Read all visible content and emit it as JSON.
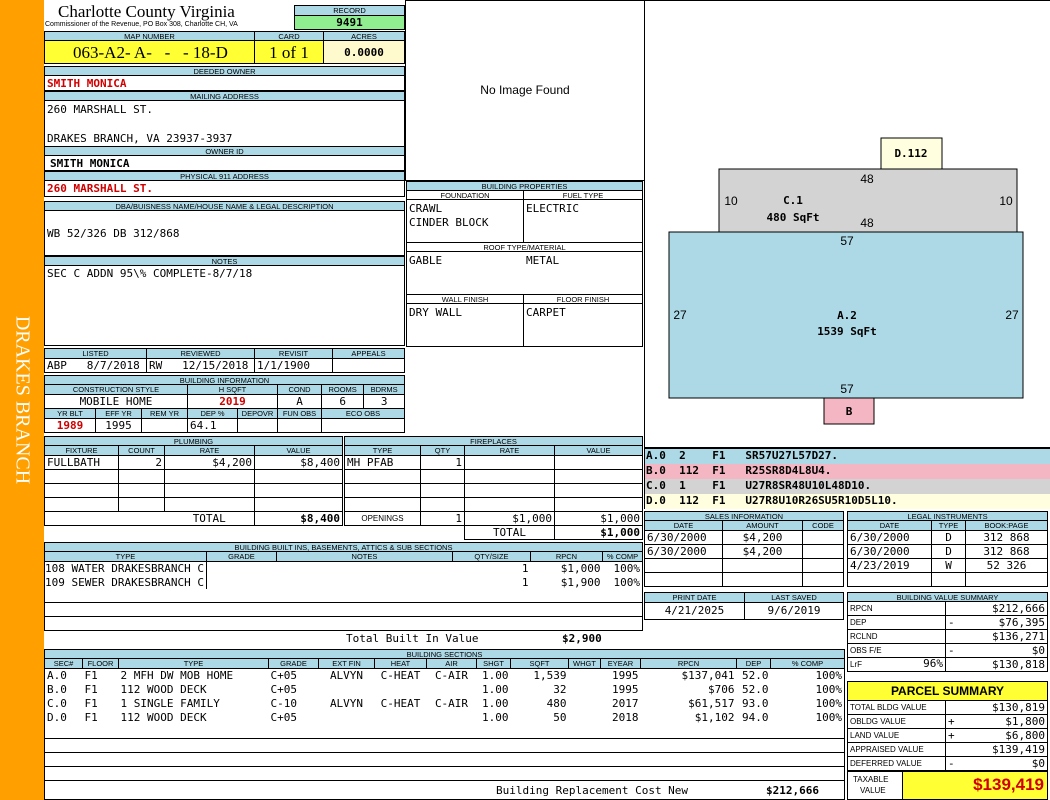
{
  "side_label": "DRAKES BRANCH",
  "header": {
    "county": "Charlotte County Virginia",
    "commissioner": "Commissioner of the Revenue, PO Box 308, Charlotte CH, VA",
    "record_label": "RECORD",
    "record": "9491",
    "map_number_label": "MAP NUMBER",
    "map_number": "063-A2- A-   -   - 18-D",
    "card_label": "CARD",
    "card": "1 of 1",
    "acres_label": "ACRES",
    "acres": "0.0000"
  },
  "owner": {
    "deeded_owner_label": "DEEDED OWNER",
    "deeded_owner": "SMITH MONICA",
    "mailing_label": "MAILING ADDRESS",
    "mailing_line1": "260 MARSHALL ST.",
    "mailing_line2": "DRAKES BRANCH, VA 23937-3937",
    "owner_id_label": "OWNER ID",
    "owner_id": "SMITH MONICA",
    "physical_label": "PHYSICAL 911 ADDRESS",
    "physical": "260 MARSHALL ST.",
    "dba_label": "DBA/BUISNESS NAME/HOUSE NAME & LEGAL DESCRIPTION",
    "dba": "WB 52/326 DB 312/868",
    "notes_label": "NOTES",
    "notes": "SEC C ADDN 95\\% COMPLETE-8/7/18"
  },
  "image_placeholder": "No Image Found",
  "building_properties": {
    "title": "BUILDING PROPERTIES",
    "foundation_label": "FOUNDATION",
    "foundation": [
      "CRAWL",
      "CINDER BLOCK"
    ],
    "fuel_label": "FUEL TYPE",
    "fuel": "ELECTRIC",
    "roof_label": "ROOF TYPE/MATERIAL",
    "roof_type": "GABLE",
    "roof_material": "METAL",
    "wall_label": "WALL FINISH",
    "wall": "DRY WALL",
    "floor_label": "FLOOR FINISH",
    "floor": "CARPET"
  },
  "listing": {
    "listed_label": "LISTED",
    "listed_by": "ABP",
    "listed_date": "8/7/2018",
    "reviewed_label": "REVIEWED",
    "reviewed_by": "RW",
    "reviewed_date": "12/15/2018",
    "revisit_label": "REVISIT",
    "revisit": "1/1/1900",
    "appeals_label": "APPEALS",
    "appeals": ""
  },
  "building_info": {
    "title": "BUILDING INFORMATION",
    "style_label": "CONSTRUCTION STYLE",
    "style": "MOBILE HOME",
    "hsqft_label": "H SQFT",
    "hsqft": "2019",
    "cond_label": "COND",
    "cond": "A",
    "rooms_label": "ROOMS",
    "rooms": "6",
    "bdrms_label": "BDRMS",
    "bdrms": "3",
    "yrblt_label": "YR BLT",
    "yrblt": "1989",
    "effyr_label": "EFF YR",
    "effyr": "1995",
    "remyr_label": "REM YR",
    "remyr": "",
    "dep_label": "DEP %",
    "dep": "64.1",
    "depovr_label": "DEPOVR",
    "depovr": "",
    "funobs_label": "FUN OBS",
    "funobs": "",
    "ecoobs_label": "ECO OBS",
    "ecoobs": ""
  },
  "plumbing": {
    "title": "PLUMBING",
    "headers": [
      "FIXTURE",
      "COUNT",
      "RATE",
      "VALUE"
    ],
    "rows": [
      [
        "FULLBATH",
        "2",
        "$4,200",
        "$8,400"
      ]
    ],
    "total_label": "TOTAL",
    "total": "$8,400"
  },
  "fireplaces": {
    "title": "FIREPLACES",
    "headers": [
      "TYPE",
      "QTY",
      "RATE",
      "VALUE"
    ],
    "rows": [
      [
        "MH PFAB",
        "1",
        "",
        ""
      ]
    ],
    "openings_label": "OPENINGS",
    "openings_qty": "1",
    "openings_rate": "$1,000",
    "openings_value": "$1,000",
    "total_label": "TOTAL",
    "total": "$1,000"
  },
  "built_ins": {
    "title": "BUILDING BUILT INS, BASEMENTS, ATTICS & SUB SECTIONS",
    "headers": [
      "TYPE",
      "GRADE",
      "NOTES",
      "QTY/SIZE",
      "RPCN",
      "% COMP"
    ],
    "rows": [
      [
        "108 WATER DRAKESBRANCH C",
        "",
        "",
        "1",
        "$1,000",
        "100%"
      ],
      [
        "109 SEWER DRAKESBRANCH C",
        "",
        "",
        "1",
        "$1,900",
        "100%"
      ]
    ],
    "total_label": "Total Built In Value",
    "total": "$2,900"
  },
  "sketch": {
    "labels": {
      "d_code": "D.112",
      "c_code": "C.1",
      "c_area": "480 SqFt",
      "a_code": "A.2",
      "a_area": "1539 SqFt",
      "b_code": "B",
      "c_top": "48",
      "c_bottom": "48",
      "c_left": "10",
      "c_right": "10",
      "a_top": "57",
      "a_bottom": "57",
      "a_left": "27",
      "a_right": "27"
    },
    "colors": {
      "a_fill": "#add8e6",
      "b_fill": "#f4b6c2",
      "c_fill": "#d3d3d3",
      "d_fill": "#ffffe0"
    },
    "legend": [
      {
        "text": "A.0  2    F1   SR57U27L57D27.",
        "color": "#add8e6"
      },
      {
        "text": "B.0  112  F1   R25SR8D4L8U4.",
        "color": "#f4b6c2"
      },
      {
        "text": "C.0  1    F1   U27R8SR48U10L48D10.",
        "color": "#d3d3d3"
      },
      {
        "text": "D.0  112  F1   U27R8U10R26SU5R10D5L10.",
        "color": "#ffffe0"
      }
    ]
  },
  "sales": {
    "title": "SALES INFORMATION",
    "headers": [
      "DATE",
      "AMOUNT",
      "CODE"
    ],
    "rows": [
      [
        "6/30/2000",
        "$4,200",
        ""
      ],
      [
        "6/30/2000",
        "$4,200",
        ""
      ]
    ]
  },
  "legal": {
    "title": "LEGAL INSTRUMENTS",
    "headers": [
      "DATE",
      "TYPE",
      "BOOK:PAGE"
    ],
    "rows": [
      [
        "6/30/2000",
        "D",
        "312 868"
      ],
      [
        "6/30/2000",
        "D",
        "312 868"
      ],
      [
        "4/23/2019",
        "W",
        "52 326"
      ]
    ]
  },
  "print": {
    "print_label": "PRINT DATE",
    "print_date": "4/21/2025",
    "saved_label": "LAST SAVED",
    "saved_date": "9/6/2019"
  },
  "value_summary": {
    "title": "BUILDING VALUE SUMMARY",
    "rows": [
      {
        "label": "RPCN",
        "sign": "",
        "value": "$212,666"
      },
      {
        "label": "DEP",
        "sign": "-",
        "value": "$76,395"
      },
      {
        "label": "RCLND",
        "sign": "",
        "value": "$136,271"
      },
      {
        "label": "OBS F/E",
        "sign": "-",
        "value": "$0"
      },
      {
        "label": "LrF",
        "sign": "96%",
        "value": "$130,818"
      }
    ]
  },
  "parcel": {
    "title": "PARCEL SUMMARY",
    "rows": [
      {
        "label": "TOTAL BLDG VALUE",
        "sign": "",
        "value": "$130,819"
      },
      {
        "label": "OBLDG VALUE",
        "sign": "+",
        "value": "$1,800"
      },
      {
        "label": "LAND VALUE",
        "sign": "+",
        "value": "$6,800"
      },
      {
        "label": "APPRAISED VALUE",
        "sign": "",
        "value": "$139,419"
      },
      {
        "label": "DEFERRED VALUE",
        "sign": "-",
        "value": "$0"
      }
    ],
    "taxable_label_1": "TAXABLE",
    "taxable_label_2": "VALUE",
    "taxable": "$139,419"
  },
  "sections": {
    "title": "BUILDING SECTIONS",
    "headers": [
      "SEC#",
      "FLOOR",
      "TYPE",
      "GRADE",
      "EXT FIN",
      "HEAT",
      "AIR",
      "SHGT",
      "SQFT",
      "WHGT",
      "EYEAR",
      "RPCN",
      "DEP",
      "% COMP"
    ],
    "rows": [
      [
        "A.0",
        "F1",
        "2 MFH DW MOB HOME",
        "C+05",
        "ALVYN",
        "C-HEAT",
        "C-AIR",
        "1.00",
        "1,539",
        "",
        "1995",
        "$137,041",
        "52.0",
        "100%"
      ],
      [
        "B.0",
        "F1",
        "112 WOOD DECK",
        "C+05",
        "",
        "",
        "",
        "1.00",
        "32",
        "",
        "1995",
        "$706",
        "52.0",
        "100%"
      ],
      [
        "C.0",
        "F1",
        "1 SINGLE FAMILY",
        "C-10",
        "ALVYN",
        "C-HEAT",
        "C-AIR",
        "1.00",
        "480",
        "",
        "2017",
        "$61,517",
        "93.0",
        "100%"
      ],
      [
        "D.0",
        "F1",
        "112 WOOD DECK",
        "C+05",
        "",
        "",
        "",
        "1.00",
        "50",
        "",
        "2018",
        "$1,102",
        "94.0",
        "100%"
      ]
    ],
    "total_label": "Building Replacement Cost New",
    "total": "$212,666"
  }
}
